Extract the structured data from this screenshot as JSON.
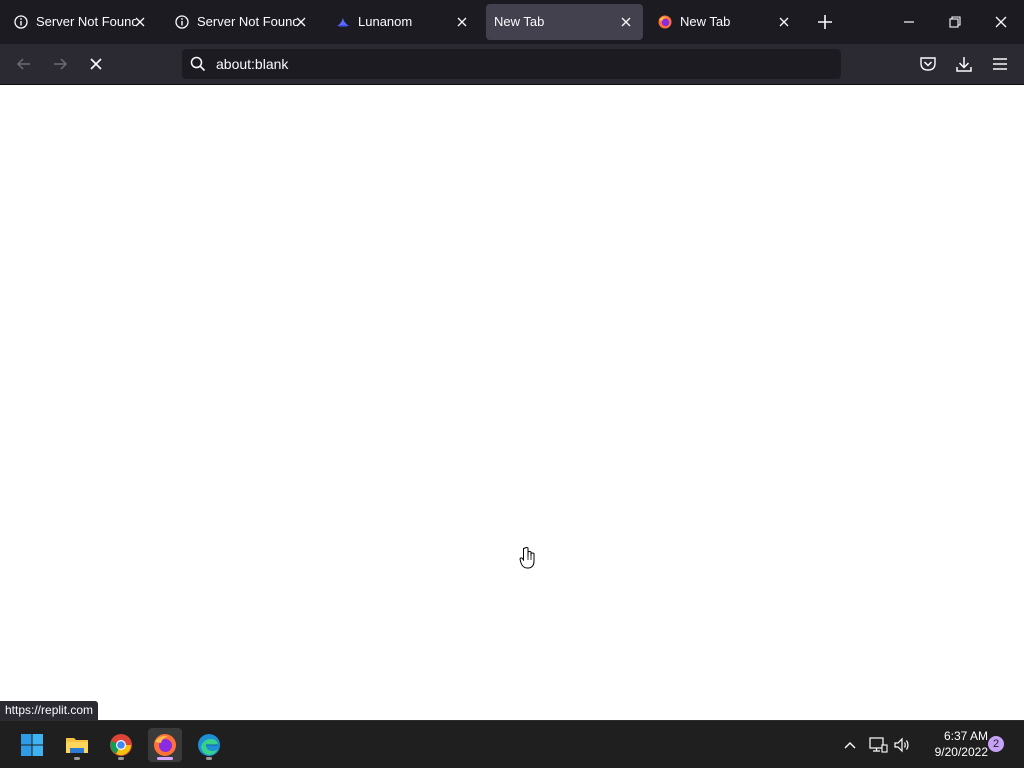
{
  "browser": {
    "tabs": [
      {
        "label": "Server Not Found",
        "icon": "info-icon",
        "active": false
      },
      {
        "label": "Server Not Found",
        "icon": "info-icon",
        "active": false
      },
      {
        "label": "Lunanom",
        "icon": "lunanom-favicon",
        "active": false
      },
      {
        "label": "New Tab",
        "icon": "",
        "active": true
      },
      {
        "label": "New Tab",
        "icon": "firefox-icon",
        "active": false
      }
    ],
    "url": "about:blank",
    "status_url": "https://replit.com"
  },
  "taskbar": {
    "apps": [
      "windows-start",
      "file-explorer",
      "chrome",
      "firefox",
      "edge"
    ],
    "time": "6:37 AM",
    "date": "9/20/2022",
    "notification_count": "2"
  },
  "colors": {
    "titlebar": "#1c1b22",
    "navbar": "#2b2a33",
    "active_tab": "#42414d",
    "taskbar": "#1f1f1f",
    "accent": "#c7a0f7"
  }
}
